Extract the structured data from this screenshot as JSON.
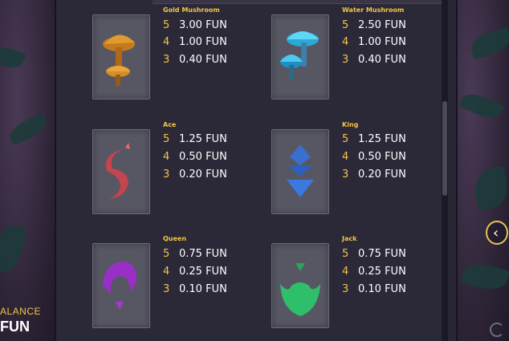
{
  "symbols": [
    {
      "name": "Gold Mushroom",
      "pays": [
        {
          "n": "5",
          "v": "3.00 FUN"
        },
        {
          "n": "4",
          "v": "1.00 FUN"
        },
        {
          "n": "3",
          "v": "0.40 FUN"
        }
      ]
    },
    {
      "name": "Water Mushroom",
      "pays": [
        {
          "n": "5",
          "v": "2.50 FUN"
        },
        {
          "n": "4",
          "v": "1.00 FUN"
        },
        {
          "n": "3",
          "v": "0.40 FUN"
        }
      ]
    },
    {
      "name": "Ace",
      "pays": [
        {
          "n": "5",
          "v": "1.25 FUN"
        },
        {
          "n": "4",
          "v": "0.50 FUN"
        },
        {
          "n": "3",
          "v": "0.20 FUN"
        }
      ]
    },
    {
      "name": "King",
      "pays": [
        {
          "n": "5",
          "v": "1.25 FUN"
        },
        {
          "n": "4",
          "v": "0.50 FUN"
        },
        {
          "n": "3",
          "v": "0.20 FUN"
        }
      ]
    },
    {
      "name": "Queen",
      "pays": [
        {
          "n": "5",
          "v": "0.75 FUN"
        },
        {
          "n": "4",
          "v": "0.25 FUN"
        },
        {
          "n": "3",
          "v": "0.10 FUN"
        }
      ]
    },
    {
      "name": "Jack",
      "pays": [
        {
          "n": "5",
          "v": "0.75 FUN"
        },
        {
          "n": "4",
          "v": "0.25 FUN"
        },
        {
          "n": "3",
          "v": "0.10 FUN"
        }
      ]
    }
  ],
  "balance": {
    "label": "ALANCE",
    "value": "FUN"
  },
  "nav": {
    "next_icon": "chevron-left-icon",
    "refresh_icon": "refresh-icon"
  },
  "colors": {
    "accent": "#f3c646",
    "panel": "#2b2838",
    "card": "#565762"
  }
}
